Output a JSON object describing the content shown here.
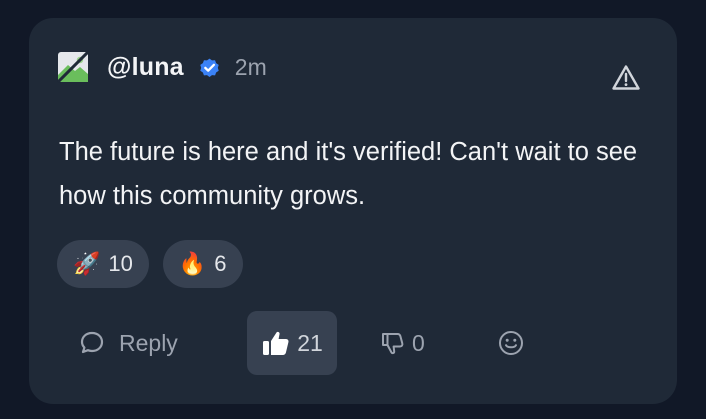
{
  "post": {
    "author": "@luna",
    "time": "2m",
    "body": "The future is here and it's verified! Can't wait to see how this community grows."
  },
  "reactions": [
    {
      "emoji": "🚀",
      "icon": "rocket",
      "count": "10"
    },
    {
      "emoji": "🔥",
      "icon": "fire",
      "count": "6"
    }
  ],
  "actions": {
    "reply_label": "Reply",
    "like_count": "21",
    "dislike_count": "0"
  },
  "colors": {
    "page_bg": "#111827",
    "card_bg": "#1f2937",
    "chip_bg": "#374151",
    "verified": "#3b82f6",
    "text": "#f3f4f6",
    "muted": "#9ca3af"
  }
}
